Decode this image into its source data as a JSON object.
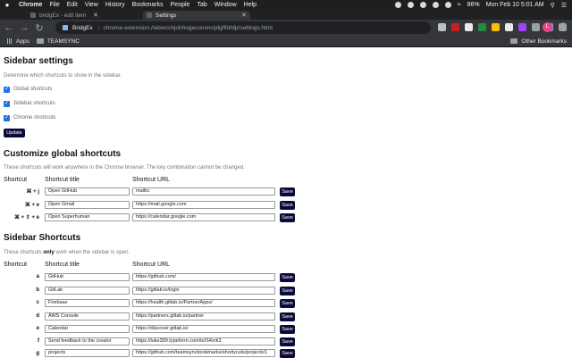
{
  "menubar": {
    "items": [
      "Chrome",
      "File",
      "Edit",
      "View",
      "History",
      "Bookmarks",
      "People",
      "Tab",
      "Window",
      "Help"
    ],
    "battery": "86%",
    "clock": "Mon Feb 10  5:01 AM"
  },
  "tabs": [
    {
      "title": "bridgEx - edit item"
    },
    {
      "title": "Settings"
    }
  ],
  "toolbar": {
    "origin": "BridgEx",
    "url": "chrome-extension://ebiecchjohhogeconcncijdgflfdhfp/settings.html",
    "profile_initial": "L"
  },
  "bookmarks": {
    "items": [
      "Apps",
      "TEAMSYNC"
    ],
    "other": "Other Bookmarks"
  },
  "sidebar_settings": {
    "heading": "Sidebar settings",
    "description": "Determine which shortcuts to show in the sidebar.",
    "options": [
      {
        "label": "Global shortcuts",
        "checked": true
      },
      {
        "label": "Sidebar shortcuts",
        "checked": true
      },
      {
        "label": "Chrome shortcuts",
        "checked": true
      }
    ],
    "update_label": "Update"
  },
  "global_shortcuts": {
    "heading": "Customize global shortcuts",
    "description": "These shortcuts will work anywhere in the Chrome browser. The key combination cannot be changed.",
    "columns": [
      "Shortcut",
      "Shortcut title",
      "Shortcut URL"
    ],
    "rows": [
      {
        "key": "⌘ + j",
        "title": "Open GitHub",
        "url": "mailto:",
        "save": "Save"
      },
      {
        "key": "⌘ + e",
        "title": "Open Gmail",
        "url": "https://mail.google.com",
        "save": "Save"
      },
      {
        "key": "⌘ + ⇧ + e",
        "title": "Open Superhuman",
        "url": "https://calendar.google.com",
        "save": "Save"
      }
    ]
  },
  "sidebar_shortcuts": {
    "heading": "Sidebar Shortcuts",
    "description_prefix": "These shortcuts ",
    "description_bold": "only",
    "description_suffix": " work when the sidebar is open.",
    "columns": [
      "Shortcut",
      "Shortcut title",
      "Shortcut URL"
    ],
    "rows": [
      {
        "key": "a",
        "title": "GitHub",
        "url": "https://github.com/",
        "save": "Save"
      },
      {
        "key": "b",
        "title": "GitLab",
        "url": "https://gitlab.io/login",
        "save": "Save"
      },
      {
        "key": "c",
        "title": "Firebase",
        "url": "https://health.gitlab.io/PartnerApps/",
        "save": "Save"
      },
      {
        "key": "d",
        "title": "AWS Console",
        "url": "https://partners.gitlab.io/partner",
        "save": "Save"
      },
      {
        "key": "e",
        "title": "Calendar",
        "url": "https://discover.gitlab.io/",
        "save": "Save"
      },
      {
        "key": "f",
        "title": "Send feedback to the creator",
        "url": "https://luke399.typeform.com/to/S4zrk3",
        "save": "Save"
      },
      {
        "key": "g",
        "title": "projects",
        "url": "https://github.com/teamsyncbookmarks/shortycuts/projects/1",
        "save": "Save"
      }
    ]
  },
  "colors": {
    "button": "#0b0b3b",
    "checkbox": "#1a73e8",
    "chrome_dark": "#35363a"
  }
}
